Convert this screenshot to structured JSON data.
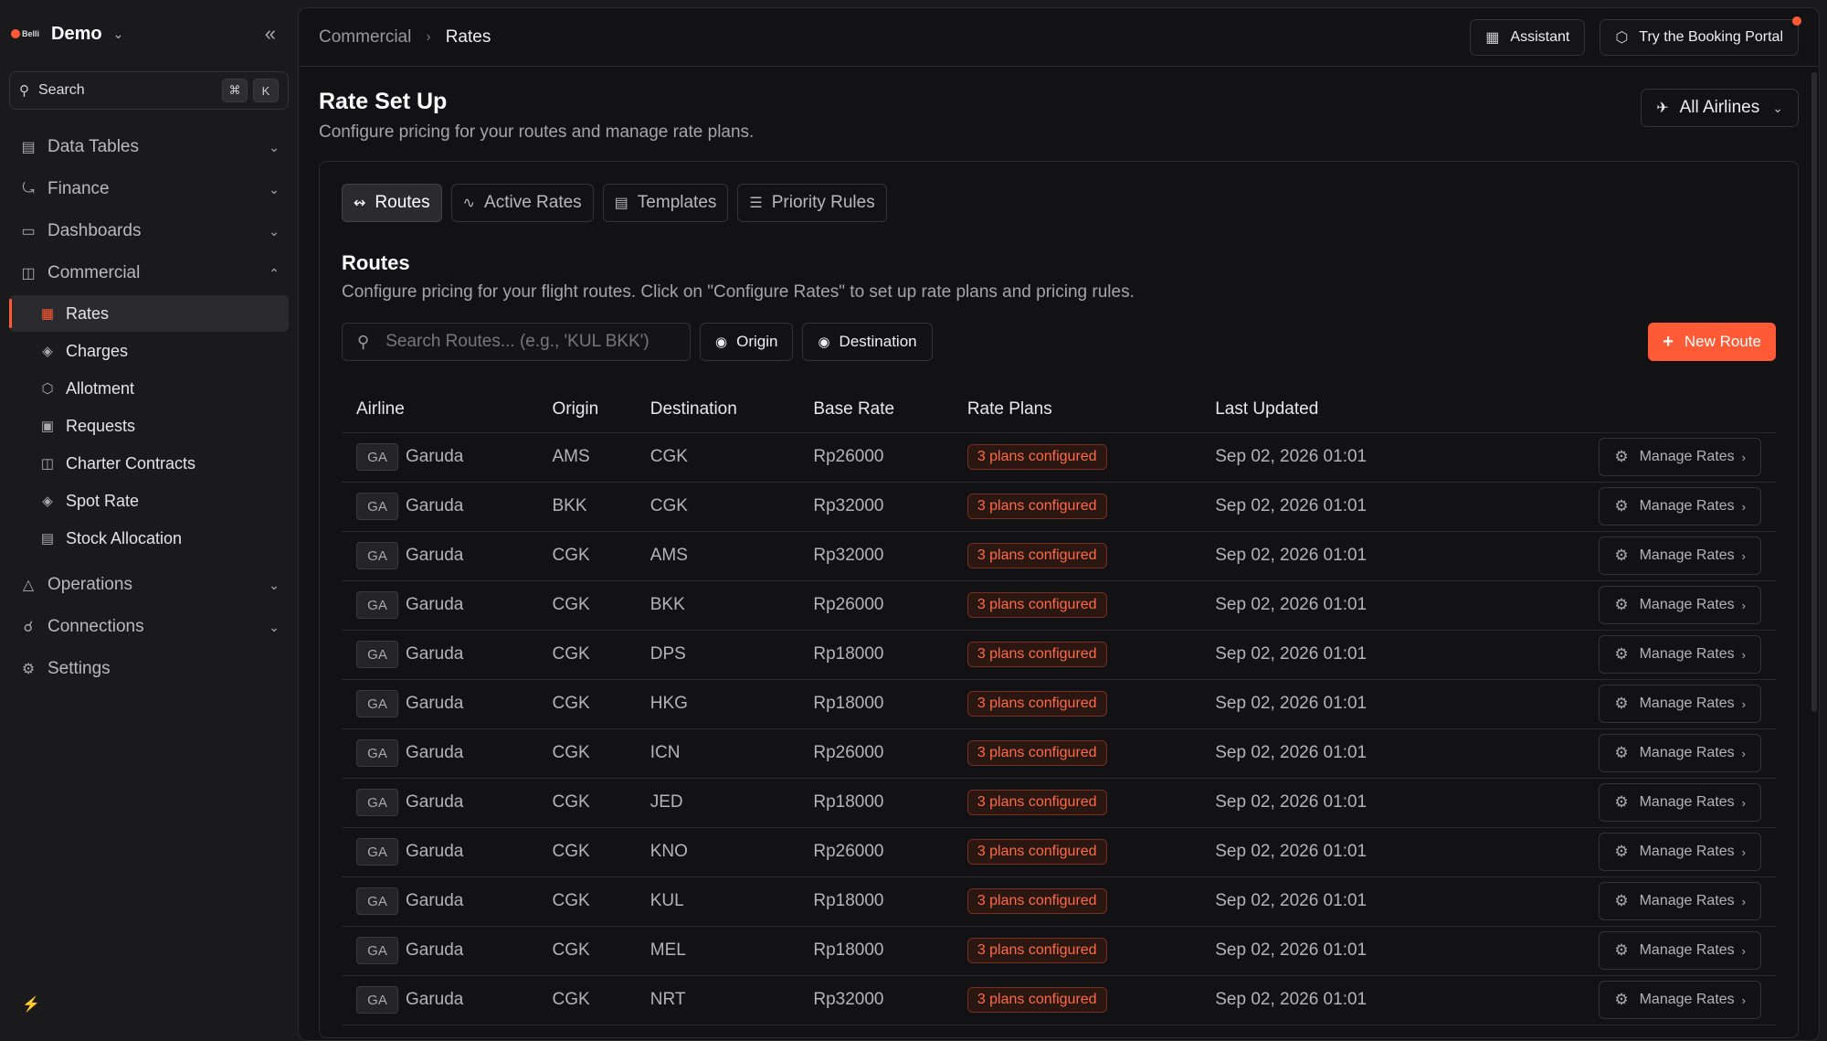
{
  "sidebar": {
    "brand_text": "Belli",
    "brand_name": "Demo",
    "search_label": "Search",
    "search_kbd": [
      "⌘",
      "K"
    ],
    "groups": [
      {
        "label": "Data Tables"
      },
      {
        "label": "Finance"
      },
      {
        "label": "Dashboards"
      },
      {
        "label": "Commercial"
      }
    ],
    "commercial_items": [
      {
        "label": "Rates"
      },
      {
        "label": "Charges"
      },
      {
        "label": "Allotment"
      },
      {
        "label": "Requests"
      },
      {
        "label": "Charter Contracts"
      },
      {
        "label": "Spot Rate"
      },
      {
        "label": "Stock Allocation"
      }
    ],
    "bottom_groups": [
      {
        "label": "Operations"
      },
      {
        "label": "Connections"
      },
      {
        "label": "Settings"
      }
    ]
  },
  "topbar": {
    "breadcrumb_parent": "Commercial",
    "breadcrumb_current": "Rates",
    "assistant_label": "Assistant",
    "portal_label": "Try the Booking Portal"
  },
  "page": {
    "title": "Rate Set Up",
    "subtitle": "Configure pricing for your routes and manage rate plans.",
    "airline_filter": "All Airlines"
  },
  "tabs": [
    {
      "label": "Routes"
    },
    {
      "label": "Active Rates"
    },
    {
      "label": "Templates"
    },
    {
      "label": "Priority Rules"
    }
  ],
  "routes": {
    "title": "Routes",
    "subtitle": "Configure pricing for your flight routes. Click on \"Configure Rates\" to set up rate plans and pricing rules.",
    "search_placeholder": "Search Routes... (e.g., 'KUL BKK')",
    "origin_label": "Origin",
    "destination_label": "Destination",
    "new_route_label": "New Route",
    "columns": [
      "Airline",
      "Origin",
      "Destination",
      "Base Rate",
      "Rate Plans",
      "Last Updated"
    ],
    "manage_label": "Manage Rates",
    "rows": [
      {
        "code": "GA",
        "airline": "Garuda",
        "origin": "AMS",
        "destination": "CGK",
        "base_rate": "Rp26000",
        "plans": "3 plans configured",
        "updated": "Sep 02, 2026 01:01"
      },
      {
        "code": "GA",
        "airline": "Garuda",
        "origin": "BKK",
        "destination": "CGK",
        "base_rate": "Rp32000",
        "plans": "3 plans configured",
        "updated": "Sep 02, 2026 01:01"
      },
      {
        "code": "GA",
        "airline": "Garuda",
        "origin": "CGK",
        "destination": "AMS",
        "base_rate": "Rp32000",
        "plans": "3 plans configured",
        "updated": "Sep 02, 2026 01:01"
      },
      {
        "code": "GA",
        "airline": "Garuda",
        "origin": "CGK",
        "destination": "BKK",
        "base_rate": "Rp26000",
        "plans": "3 plans configured",
        "updated": "Sep 02, 2026 01:01"
      },
      {
        "code": "GA",
        "airline": "Garuda",
        "origin": "CGK",
        "destination": "DPS",
        "base_rate": "Rp18000",
        "plans": "3 plans configured",
        "updated": "Sep 02, 2026 01:01"
      },
      {
        "code": "GA",
        "airline": "Garuda",
        "origin": "CGK",
        "destination": "HKG",
        "base_rate": "Rp18000",
        "plans": "3 plans configured",
        "updated": "Sep 02, 2026 01:01"
      },
      {
        "code": "GA",
        "airline": "Garuda",
        "origin": "CGK",
        "destination": "ICN",
        "base_rate": "Rp26000",
        "plans": "3 plans configured",
        "updated": "Sep 02, 2026 01:01"
      },
      {
        "code": "GA",
        "airline": "Garuda",
        "origin": "CGK",
        "destination": "JED",
        "base_rate": "Rp18000",
        "plans": "3 plans configured",
        "updated": "Sep 02, 2026 01:01"
      },
      {
        "code": "GA",
        "airline": "Garuda",
        "origin": "CGK",
        "destination": "KNO",
        "base_rate": "Rp26000",
        "plans": "3 plans configured",
        "updated": "Sep 02, 2026 01:01"
      },
      {
        "code": "GA",
        "airline": "Garuda",
        "origin": "CGK",
        "destination": "KUL",
        "base_rate": "Rp18000",
        "plans": "3 plans configured",
        "updated": "Sep 02, 2026 01:01"
      },
      {
        "code": "GA",
        "airline": "Garuda",
        "origin": "CGK",
        "destination": "MEL",
        "base_rate": "Rp18000",
        "plans": "3 plans configured",
        "updated": "Sep 02, 2026 01:01"
      },
      {
        "code": "GA",
        "airline": "Garuda",
        "origin": "CGK",
        "destination": "NRT",
        "base_rate": "Rp32000",
        "plans": "3 plans configured",
        "updated": "Sep 02, 2026 01:01"
      }
    ]
  },
  "colors": {
    "accent": "#ff5a36",
    "background": "#121214",
    "sidebar": "#1a1a1c"
  }
}
